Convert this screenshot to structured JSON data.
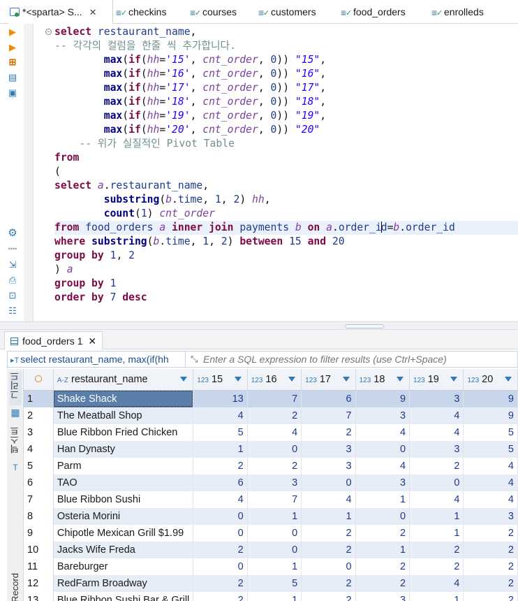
{
  "editor_tabs": [
    {
      "label": "*<sparta> S...",
      "active": true
    },
    {
      "label": "checkins"
    },
    {
      "label": "courses"
    },
    {
      "label": "customers"
    },
    {
      "label": "food_orders"
    },
    {
      "label": "enrolleds"
    }
  ],
  "sql_lines": [
    [
      [
        "kw",
        "select"
      ],
      [
        "pl",
        " "
      ],
      [
        "id",
        "restaurant_name"
      ],
      [
        "pl",
        ","
      ]
    ],
    [
      [
        "cm",
        "-- 각각의 컬럼을 한줄 씩 추가합니다."
      ]
    ],
    [
      [
        "pl",
        "        "
      ],
      [
        "fn",
        "max"
      ],
      [
        "pl",
        "("
      ],
      [
        "kw",
        "if"
      ],
      [
        "pl",
        "("
      ],
      [
        "al",
        "hh"
      ],
      [
        "pl",
        "="
      ],
      [
        "str",
        "'15'"
      ],
      [
        "pl",
        ", "
      ],
      [
        "al",
        "cnt_order"
      ],
      [
        "pl",
        ", "
      ],
      [
        "num",
        "0"
      ],
      [
        "pl",
        ")) "
      ],
      [
        "str",
        "\"15\""
      ],
      [
        "pl",
        ","
      ]
    ],
    [
      [
        "pl",
        "        "
      ],
      [
        "fn",
        "max"
      ],
      [
        "pl",
        "("
      ],
      [
        "kw",
        "if"
      ],
      [
        "pl",
        "("
      ],
      [
        "al",
        "hh"
      ],
      [
        "pl",
        "="
      ],
      [
        "str",
        "'16'"
      ],
      [
        "pl",
        ", "
      ],
      [
        "al",
        "cnt_order"
      ],
      [
        "pl",
        ", "
      ],
      [
        "num",
        "0"
      ],
      [
        "pl",
        ")) "
      ],
      [
        "str",
        "\"16\""
      ],
      [
        "pl",
        ","
      ]
    ],
    [
      [
        "pl",
        "        "
      ],
      [
        "fn",
        "max"
      ],
      [
        "pl",
        "("
      ],
      [
        "kw",
        "if"
      ],
      [
        "pl",
        "("
      ],
      [
        "al",
        "hh"
      ],
      [
        "pl",
        "="
      ],
      [
        "str",
        "'17'"
      ],
      [
        "pl",
        ", "
      ],
      [
        "al",
        "cnt_order"
      ],
      [
        "pl",
        ", "
      ],
      [
        "num",
        "0"
      ],
      [
        "pl",
        ")) "
      ],
      [
        "str",
        "\"17\""
      ],
      [
        "pl",
        ","
      ]
    ],
    [
      [
        "pl",
        "        "
      ],
      [
        "fn",
        "max"
      ],
      [
        "pl",
        "("
      ],
      [
        "kw",
        "if"
      ],
      [
        "pl",
        "("
      ],
      [
        "al",
        "hh"
      ],
      [
        "pl",
        "="
      ],
      [
        "str",
        "'18'"
      ],
      [
        "pl",
        ", "
      ],
      [
        "al",
        "cnt_order"
      ],
      [
        "pl",
        ", "
      ],
      [
        "num",
        "0"
      ],
      [
        "pl",
        ")) "
      ],
      [
        "str",
        "\"18\""
      ],
      [
        "pl",
        ","
      ]
    ],
    [
      [
        "pl",
        "        "
      ],
      [
        "fn",
        "max"
      ],
      [
        "pl",
        "("
      ],
      [
        "kw",
        "if"
      ],
      [
        "pl",
        "("
      ],
      [
        "al",
        "hh"
      ],
      [
        "pl",
        "="
      ],
      [
        "str",
        "'19'"
      ],
      [
        "pl",
        ", "
      ],
      [
        "al",
        "cnt_order"
      ],
      [
        "pl",
        ", "
      ],
      [
        "num",
        "0"
      ],
      [
        "pl",
        ")) "
      ],
      [
        "str",
        "\"19\""
      ],
      [
        "pl",
        ","
      ]
    ],
    [
      [
        "pl",
        "        "
      ],
      [
        "fn",
        "max"
      ],
      [
        "pl",
        "("
      ],
      [
        "kw",
        "if"
      ],
      [
        "pl",
        "("
      ],
      [
        "al",
        "hh"
      ],
      [
        "pl",
        "="
      ],
      [
        "str",
        "'20'"
      ],
      [
        "pl",
        ", "
      ],
      [
        "al",
        "cnt_order"
      ],
      [
        "pl",
        ", "
      ],
      [
        "num",
        "0"
      ],
      [
        "pl",
        ")) "
      ],
      [
        "str",
        "\"20\""
      ]
    ],
    [
      [
        "pl",
        "    "
      ],
      [
        "cm",
        "-- 위가 실질적인 Pivot Table"
      ]
    ],
    [
      [
        "kw",
        "from"
      ]
    ],
    [
      [
        "pl",
        "("
      ]
    ],
    [
      [
        "kw",
        "select"
      ],
      [
        "pl",
        " "
      ],
      [
        "al",
        "a"
      ],
      [
        "pl",
        "."
      ],
      [
        "id",
        "restaurant_name"
      ],
      [
        "pl",
        ","
      ]
    ],
    [
      [
        "pl",
        "        "
      ],
      [
        "fn",
        "substring"
      ],
      [
        "pl",
        "("
      ],
      [
        "al",
        "b"
      ],
      [
        "pl",
        "."
      ],
      [
        "id",
        "time"
      ],
      [
        "pl",
        ", "
      ],
      [
        "num",
        "1"
      ],
      [
        "pl",
        ", "
      ],
      [
        "num",
        "2"
      ],
      [
        "pl",
        ") "
      ],
      [
        "al",
        "hh"
      ],
      [
        "pl",
        ","
      ]
    ],
    [
      [
        "pl",
        "        "
      ],
      [
        "fn",
        "count"
      ],
      [
        "pl",
        "("
      ],
      [
        "num",
        "1"
      ],
      [
        "pl",
        ") "
      ],
      [
        "al",
        "cnt_order"
      ]
    ],
    [
      [
        "kw",
        "from"
      ],
      [
        "pl",
        " "
      ],
      [
        "id",
        "food_orders"
      ],
      [
        "pl",
        " "
      ],
      [
        "al",
        "a"
      ],
      [
        "pl",
        " "
      ],
      [
        "kw",
        "inner join"
      ],
      [
        "pl",
        " "
      ],
      [
        "id",
        "payments"
      ],
      [
        "pl",
        " "
      ],
      [
        "al",
        "b"
      ],
      [
        "pl",
        " "
      ],
      [
        "kw",
        "on"
      ],
      [
        "pl",
        " "
      ],
      [
        "al",
        "a"
      ],
      [
        "pl",
        "."
      ],
      [
        "id",
        "order_i"
      ],
      [
        "caret",
        ""
      ],
      [
        "id",
        "d"
      ],
      [
        "pl",
        "="
      ],
      [
        "al",
        "b"
      ],
      [
        "pl",
        "."
      ],
      [
        "id",
        "order_id"
      ]
    ],
    [
      [
        "kw",
        "where"
      ],
      [
        "pl",
        " "
      ],
      [
        "fn",
        "substring"
      ],
      [
        "pl",
        "("
      ],
      [
        "al",
        "b"
      ],
      [
        "pl",
        "."
      ],
      [
        "id",
        "time"
      ],
      [
        "pl",
        ", "
      ],
      [
        "num",
        "1"
      ],
      [
        "pl",
        ", "
      ],
      [
        "num",
        "2"
      ],
      [
        "pl",
        ") "
      ],
      [
        "kw",
        "between"
      ],
      [
        "pl",
        " "
      ],
      [
        "num",
        "15"
      ],
      [
        "pl",
        " "
      ],
      [
        "kw",
        "and"
      ],
      [
        "pl",
        " "
      ],
      [
        "num",
        "20"
      ]
    ],
    [
      [
        "kw",
        "group by"
      ],
      [
        "pl",
        " "
      ],
      [
        "num",
        "1"
      ],
      [
        "pl",
        ", "
      ],
      [
        "num",
        "2"
      ]
    ],
    [
      [
        "pl",
        ") "
      ],
      [
        "al",
        "a"
      ]
    ],
    [
      [
        "kw",
        "group by"
      ],
      [
        "pl",
        " "
      ],
      [
        "num",
        "1"
      ]
    ],
    [
      [
        "kw",
        "order by"
      ],
      [
        "pl",
        " "
      ],
      [
        "num",
        "7"
      ],
      [
        "pl",
        " "
      ],
      [
        "kw",
        "desc"
      ]
    ]
  ],
  "highlight_line": 14,
  "results_tab": {
    "label": "food_orders 1"
  },
  "filter": {
    "query": "select restaurant_name, max(if(hh",
    "placeholder": "Enter a SQL expression to filter results (use Ctrl+Space)"
  },
  "vertical_tabs": {
    "grid": "그리드",
    "text": "텍스트",
    "record": "Record"
  },
  "columns": [
    {
      "label": "restaurant_name",
      "type_icon": "A-Z"
    },
    {
      "label": "15",
      "type_icon": "123"
    },
    {
      "label": "16",
      "type_icon": "123"
    },
    {
      "label": "17",
      "type_icon": "123"
    },
    {
      "label": "18",
      "type_icon": "123"
    },
    {
      "label": "19",
      "type_icon": "123"
    },
    {
      "label": "20",
      "type_icon": "123"
    }
  ],
  "rows": [
    {
      "n": "1",
      "name": "Shake Shack",
      "v": [
        13,
        7,
        6,
        9,
        3,
        9
      ]
    },
    {
      "n": "2",
      "name": "The Meatball Shop",
      "v": [
        4,
        2,
        7,
        3,
        4,
        9
      ]
    },
    {
      "n": "3",
      "name": "Blue Ribbon Fried Chicken",
      "v": [
        5,
        4,
        2,
        4,
        4,
        5
      ]
    },
    {
      "n": "4",
      "name": "Han Dynasty",
      "v": [
        1,
        0,
        3,
        0,
        3,
        5
      ]
    },
    {
      "n": "5",
      "name": "Parm",
      "v": [
        2,
        2,
        3,
        4,
        2,
        4
      ]
    },
    {
      "n": "6",
      "name": "TAO",
      "v": [
        6,
        3,
        0,
        3,
        0,
        4
      ]
    },
    {
      "n": "7",
      "name": "Blue Ribbon Sushi",
      "v": [
        4,
        7,
        4,
        1,
        4,
        4
      ]
    },
    {
      "n": "8",
      "name": "Osteria Morini",
      "v": [
        0,
        1,
        1,
        0,
        1,
        3
      ]
    },
    {
      "n": "9",
      "name": "Chipotle Mexican Grill $1.99",
      "v": [
        0,
        0,
        2,
        2,
        1,
        2
      ]
    },
    {
      "n": "10",
      "name": "Jacks Wife Freda",
      "v": [
        2,
        0,
        2,
        1,
        2,
        2
      ]
    },
    {
      "n": "11",
      "name": "Bareburger",
      "v": [
        0,
        1,
        0,
        2,
        2,
        2
      ]
    },
    {
      "n": "12",
      "name": "RedFarm Broadway",
      "v": [
        2,
        5,
        2,
        2,
        4,
        2
      ]
    },
    {
      "n": "13",
      "name": "Blue Ribbon Sushi Bar & Grill",
      "v": [
        2,
        1,
        2,
        3,
        1,
        2
      ]
    }
  ],
  "selected_row": 0
}
